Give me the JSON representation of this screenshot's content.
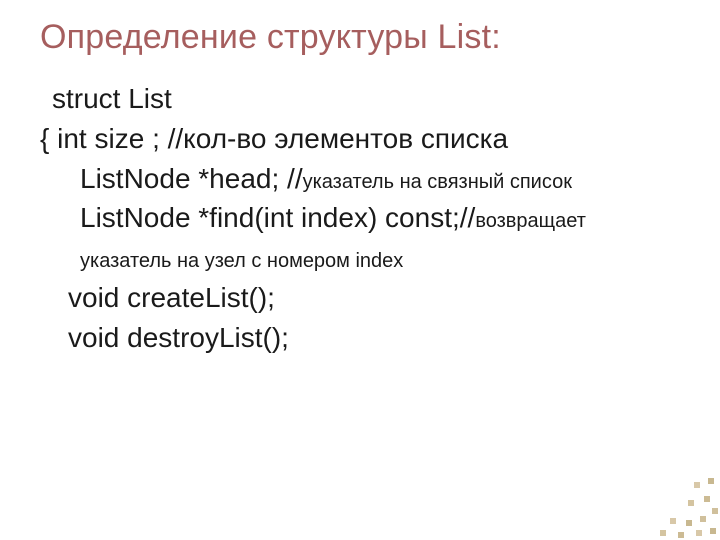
{
  "title": "Определение структуры List:",
  "lines": {
    "l1": "struct List",
    "l2a": "{",
    "l2b": "int size ; //кол-во элементов списка",
    "l3a": "ListNode *head; //",
    "l3b": "указатель на связный список",
    "l4": "ListNode *find(int index) const;//",
    "l4b": "возвращает указатель на узел с номером index",
    "l5": "void createList();",
    "l6": "void destroyList();"
  }
}
